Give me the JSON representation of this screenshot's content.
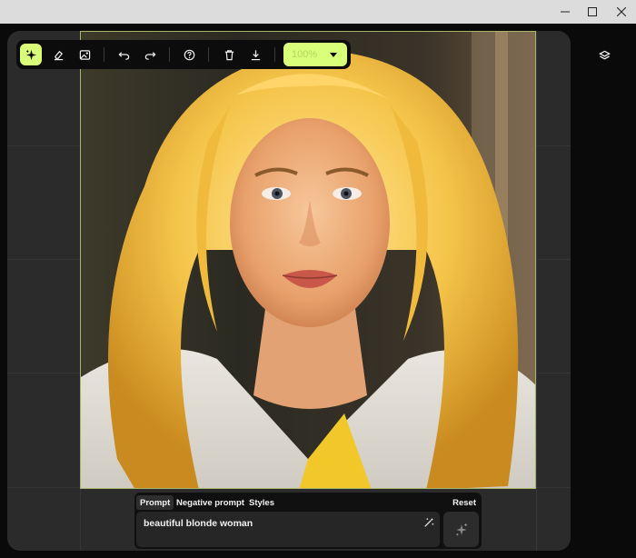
{
  "window": {
    "minimize_icon": "minimize-icon",
    "maximize_icon": "maximize-icon",
    "close_icon": "close-icon"
  },
  "toolbar": {
    "tools": [
      {
        "name": "generative-fill",
        "icon": "sparkle-icon",
        "active": true
      },
      {
        "name": "eraser",
        "icon": "eraser-icon",
        "active": false
      },
      {
        "name": "image",
        "icon": "image-icon",
        "active": false
      },
      {
        "name": "undo",
        "icon": "undo-icon",
        "active": false
      },
      {
        "name": "redo",
        "icon": "redo-icon",
        "active": false
      },
      {
        "name": "help",
        "icon": "help-icon",
        "active": false
      },
      {
        "name": "delete",
        "icon": "trash-icon",
        "active": false
      },
      {
        "name": "download",
        "icon": "download-icon",
        "active": false
      }
    ],
    "zoom_value": "100%"
  },
  "sidebar": {
    "layers_icon": "layers-icon"
  },
  "prompt": {
    "tabs": [
      {
        "label": "Prompt",
        "active": true
      },
      {
        "label": "Negative prompt",
        "active": false
      },
      {
        "label": "Styles",
        "active": false
      }
    ],
    "reset_label": "Reset",
    "input_value": "beautiful blonde woman",
    "enhance_icon": "magic-wand-icon",
    "generate_icon": "sparkle-icon"
  },
  "colors": {
    "accent": "#d9ff7a",
    "panel_bg": "#2b2b2b",
    "app_bg": "#0a0a0a"
  }
}
